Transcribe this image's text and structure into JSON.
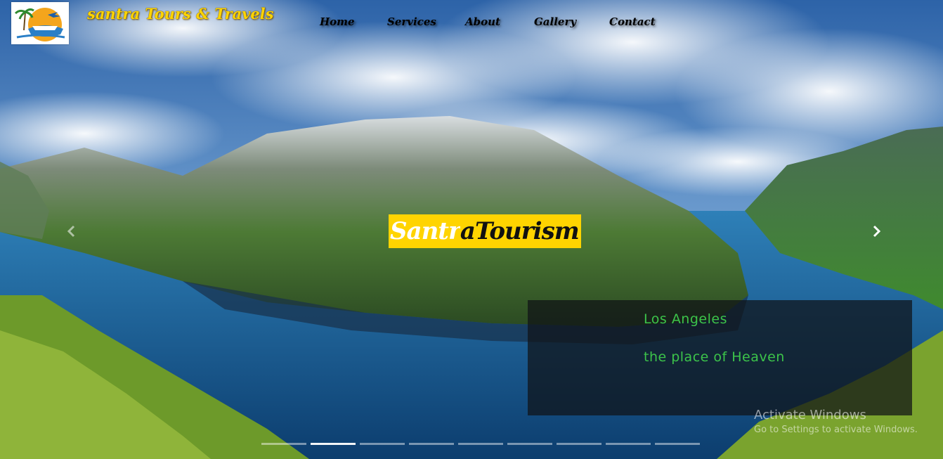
{
  "brand": {
    "name": "santra Tours & Travels"
  },
  "nav": {
    "items": [
      {
        "label": "Home"
      },
      {
        "label": "Services"
      },
      {
        "label": "About"
      },
      {
        "label": "Gallery"
      },
      {
        "label": "Contact"
      }
    ]
  },
  "hero": {
    "headline_part1": "Santr",
    "headline_part2": "aTourism",
    "caption_title": "Los Angeles",
    "caption_subtitle": "the place of Heaven"
  },
  "carousel": {
    "slide_count": 9,
    "active_index": 1,
    "prev_icon": "chevron-left-icon",
    "next_icon": "chevron-right-icon"
  },
  "watermark": {
    "title": "Activate Windows",
    "subtitle": "Go to Settings to activate Windows."
  },
  "colors": {
    "brand_yellow": "#ffd400",
    "caption_green": "#3cc44a",
    "caption_bg": "#0f1216"
  }
}
